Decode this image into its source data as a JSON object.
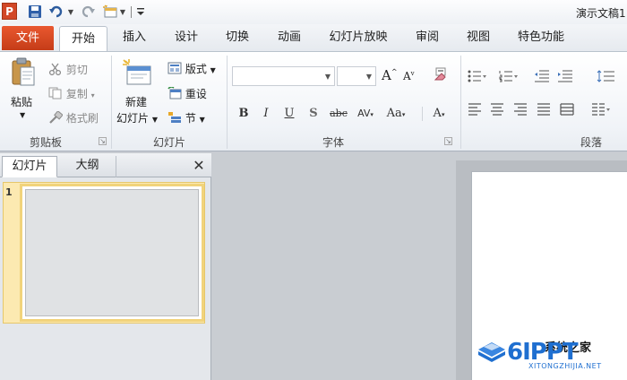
{
  "titlebar": {
    "app_icon": "P",
    "doc_title": "演示文稿1",
    "icons": [
      "powerpoint-app-icon",
      "save-icon",
      "undo-icon",
      "redo-icon",
      "new-slide-quick-icon",
      "customize-qat-icon"
    ]
  },
  "tabs": {
    "file": "文件",
    "home": "开始",
    "items": [
      "插入",
      "设计",
      "切换",
      "动画",
      "幻灯片放映",
      "审阅",
      "视图",
      "特色功能"
    ]
  },
  "clipboard": {
    "paste": "粘贴",
    "cut": "剪切",
    "copy": "复制",
    "format_painter": "格式刷",
    "group": "剪贴板"
  },
  "slides": {
    "new_slide_line1": "新建",
    "new_slide_line2": "幻灯片",
    "layout": "版式",
    "reset": "重设",
    "section": "节",
    "group": "幻灯片"
  },
  "font": {
    "group": "字体",
    "font_name": "",
    "font_size": "",
    "grow": "A",
    "shrink": "A",
    "bold": "B",
    "italic": "I",
    "underline": "U",
    "shadow": "S",
    "strikethrough": "abc",
    "spacing": "AV",
    "change_case": "Aa",
    "font_color": "A"
  },
  "paragraph": {
    "group": "段落"
  },
  "left_panel": {
    "tab_slides": "幻灯片",
    "tab_outline": "大纲",
    "close": "✕",
    "slide_number": "1"
  },
  "watermark": {
    "brand": "6IPPT",
    "url": "XITONGZHIJIA.NET",
    "overlay_text": "系统之家"
  },
  "colors": {
    "file_tab": "#d24726",
    "selection": "#fce9b1",
    "brand_blue": "#1f6fd0"
  }
}
